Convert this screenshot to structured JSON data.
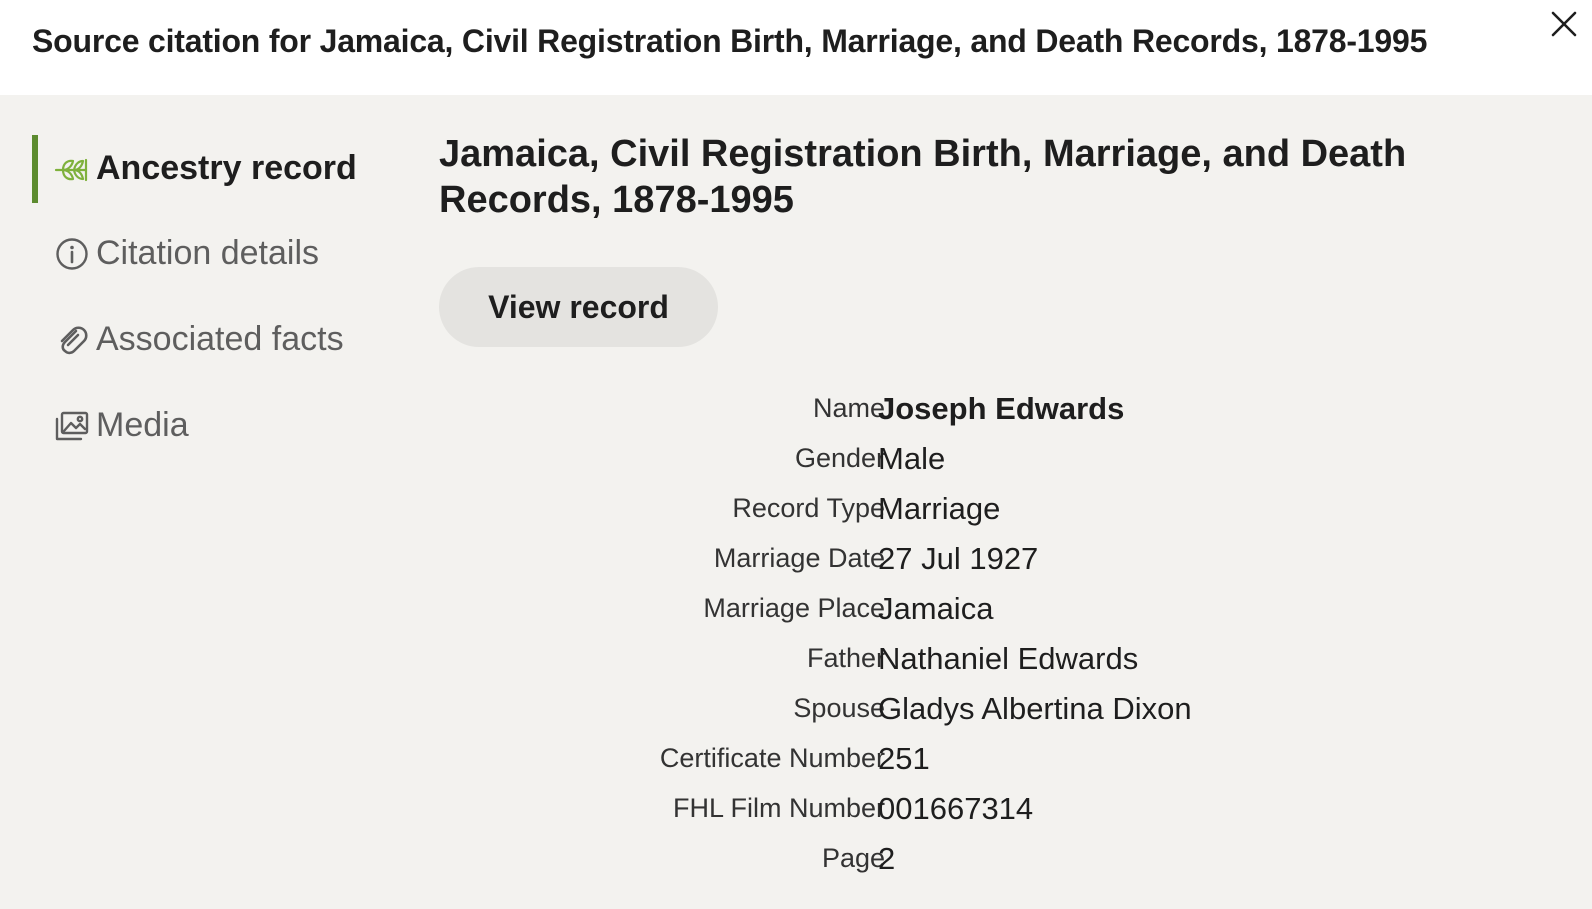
{
  "header": {
    "title": "Source citation for Jamaica, Civil Registration Birth, Marriage, and Death Records, 1878-1995",
    "close_icon": "close-icon"
  },
  "sidebar": {
    "items": [
      {
        "label": "Ancestry record",
        "icon": "leaf-icon",
        "active": true
      },
      {
        "label": "Citation details",
        "icon": "info-icon",
        "active": false
      },
      {
        "label": "Associated facts",
        "icon": "paperclip-icon",
        "active": false
      },
      {
        "label": "Media",
        "icon": "image-icon",
        "active": false
      }
    ],
    "active_color": "#5c8b2f"
  },
  "main": {
    "title": "Jamaica, Civil Registration Birth, Marriage, and Death Records, 1878-1995",
    "view_record_label": "View record",
    "fields": [
      {
        "label": "Name",
        "value": "Joseph Edwards"
      },
      {
        "label": "Gender",
        "value": "Male"
      },
      {
        "label": "Record Type",
        "value": "Marriage"
      },
      {
        "label": "Marriage Date",
        "value": "27 Jul 1927"
      },
      {
        "label": "Marriage Place",
        "value": "Jamaica"
      },
      {
        "label": "Father",
        "value": "Nathaniel Edwards"
      },
      {
        "label": "Spouse",
        "value": "Gladys Albertina Dixon"
      },
      {
        "label": "Certificate Number",
        "value": "251"
      },
      {
        "label": "FHL Film Number",
        "value": "001667314"
      },
      {
        "label": "Page",
        "value": "2"
      }
    ]
  }
}
